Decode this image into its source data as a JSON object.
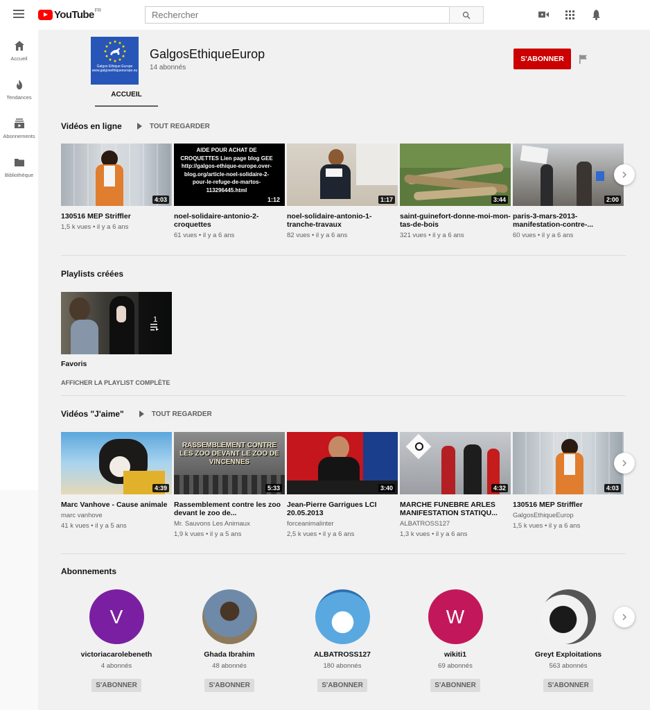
{
  "topbar": {
    "logo_text": "YouTube",
    "logo_country": "FR",
    "search_placeholder": "Rechercher"
  },
  "sidebar": {
    "items": [
      {
        "label": "Accueil",
        "icon": "home-icon"
      },
      {
        "label": "Tendances",
        "icon": "flame-icon"
      },
      {
        "label": "Abonnements",
        "icon": "subscriptions-icon"
      },
      {
        "label": "Bibliothèque",
        "icon": "folder-icon"
      }
    ]
  },
  "channel": {
    "name": "GalgosEthiqueEurop",
    "subscribers": "14 abonnés",
    "subscribe_label": "S'ABONNER",
    "avatar_text": "Galgos Ethique Europe",
    "avatar_caption": "www.galgosethiqueeurope.eu",
    "tab_home": "ACCUEIL"
  },
  "shelves": {
    "online": {
      "title": "Vidéos en ligne",
      "play_all": "TOUT REGARDER",
      "videos": [
        {
          "title": "130516 MEP Striffler",
          "meta": "1,5 k vues • il y a 6 ans",
          "duration": "4:03"
        },
        {
          "title": "noel-solidaire-antonio-2-croquettes",
          "meta": "61 vues • il y a 6 ans",
          "duration": "1:12"
        },
        {
          "title": "noel-solidaire-antonio-1-tranche-travaux",
          "meta": "82 vues • il y a 6 ans",
          "duration": "1:17"
        },
        {
          "title": "saint-guinefort-donne-moi-mon-tas-de-bois",
          "meta": "321 vues • il y a 6 ans",
          "duration": "3:44"
        },
        {
          "title": "paris-3-mars-2013-manifestation-contre-...",
          "meta": "60 vues • il y a 6 ans",
          "duration": "2:00"
        }
      ],
      "thumb2_text": "AIDE POUR ACHAT DE CROQUETTES Lien page blog GEE http://galgos-ethique-europe.over-blog.org/article-noel-solidaire-2-pour-le-refuge-de-martos-113296445.html"
    },
    "playlists": {
      "title": "Playlists créées",
      "items": [
        {
          "title": "Favoris",
          "count": "1",
          "link": "AFFICHER LA PLAYLIST COMPLÈTE"
        }
      ]
    },
    "liked": {
      "title": "Vidéos \"J'aime\"",
      "play_all": "TOUT REGARDER",
      "videos": [
        {
          "title": "Marc Vanhove - Cause animale",
          "channel": "marc vanhove",
          "meta": "41 k vues • il y a 5 ans",
          "duration": "4:39"
        },
        {
          "title": "Rassemblement contre les zoo devant le zoo de...",
          "channel": "Mr. Sauvons Les Animaux",
          "meta": "1,9 k vues • il y a 5 ans",
          "duration": "5:33"
        },
        {
          "title": "Jean-Pierre Garrigues LCI 20.05.2013",
          "channel": "forceanimalinter",
          "meta": "2,5 k vues • il y a 6 ans",
          "duration": "3:40"
        },
        {
          "title": "MARCHE FUNEBRE ARLES MANIFESTATION STATIQU...",
          "channel": "ALBATROSS127",
          "meta": "1,3 k vues • il y a 6 ans",
          "duration": "4:32"
        },
        {
          "title": "130516 MEP Striffler",
          "channel": "GalgosEthiqueEurop",
          "meta": "1,5 k vues • il y a 6 ans",
          "duration": "4:03"
        }
      ],
      "thumb2_text": "RASSEMBLEMENT CONTRE LES ZOO DEVANT LE ZOO DE VINCENNES"
    },
    "subscriptions": {
      "title": "Abonnements",
      "channels": [
        {
          "name": "victoriacarolebeneth",
          "count": "4 abonnés",
          "letter": "V",
          "color": "#7b1fa2",
          "button": "S'ABONNER"
        },
        {
          "name": "Ghada Ibrahim",
          "count": "48 abonnés",
          "letter": "",
          "color": "#8d7a5a",
          "button": "S'ABONNER"
        },
        {
          "name": "ALBATROSS127",
          "count": "180 abonnés",
          "letter": "",
          "color": "#3a8fd1",
          "button": "S'ABONNER"
        },
        {
          "name": "wikiti1",
          "count": "69 abonnés",
          "letter": "W",
          "color": "#c2185b",
          "button": "S'ABONNER"
        },
        {
          "name": "Greyt Exploitations",
          "count": "563 abonnés",
          "letter": "",
          "color": "#555555",
          "button": "S'ABONNER"
        }
      ]
    }
  }
}
